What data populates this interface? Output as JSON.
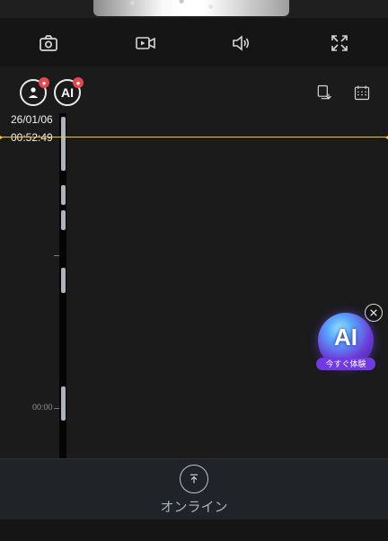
{
  "toolbar": {
    "items": [
      {
        "name": "camera",
        "icon": "camera-icon"
      },
      {
        "name": "record",
        "icon": "video-record-icon"
      },
      {
        "name": "volume",
        "icon": "speaker-icon"
      },
      {
        "name": "fullscreen",
        "icon": "fullscreen-icon"
      }
    ]
  },
  "controls": {
    "chip1_icon": "person-ai-icon",
    "chip2_text": "AI",
    "sd_icon": "sd-switch-icon",
    "calendar_icon": "calendar-icon"
  },
  "timeline": {
    "date": "26/01/06",
    "time": "00:52:49",
    "scale_label": "00:00",
    "accent": "#f3c81d"
  },
  "ai_fab": {
    "label": "AI",
    "tag": "今すぐ体験"
  },
  "bottom": {
    "label": "オンライン"
  }
}
